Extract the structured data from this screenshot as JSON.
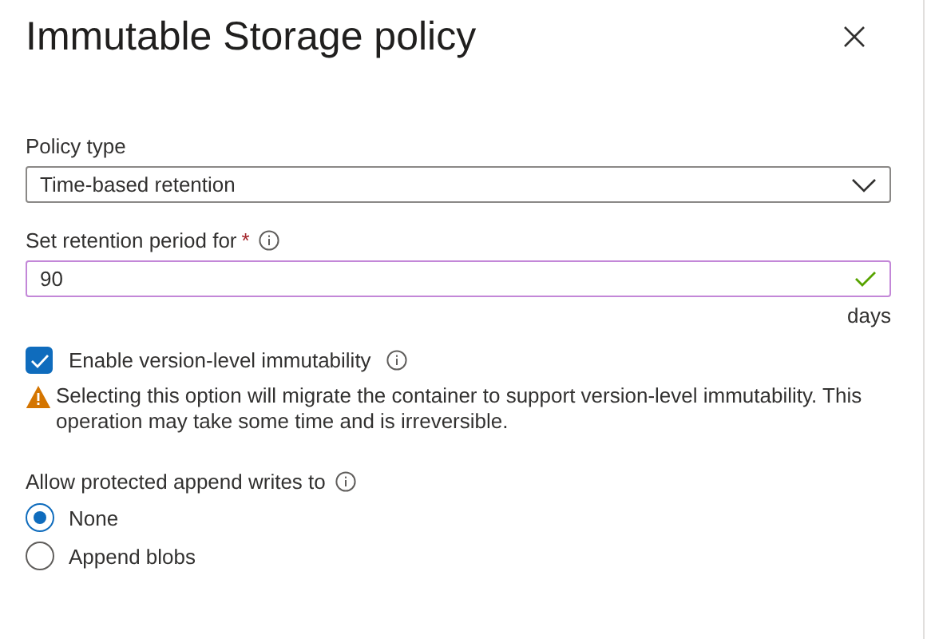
{
  "panel": {
    "title": "Immutable Storage policy"
  },
  "policy_type": {
    "label": "Policy type",
    "value": "Time-based retention"
  },
  "retention": {
    "label": "Set retention period for",
    "required_mark": "*",
    "value": "90",
    "valid": true,
    "unit": "days"
  },
  "version_immutability": {
    "label": "Enable version-level immutability",
    "checked": true,
    "warning": "Selecting this option will migrate the container to support version-level immutability. This operation may take some time and is irreversible."
  },
  "append_writes": {
    "label": "Allow protected append writes to",
    "options": [
      {
        "label": "None",
        "selected": true
      },
      {
        "label": "Append blobs",
        "selected": false
      }
    ]
  }
}
